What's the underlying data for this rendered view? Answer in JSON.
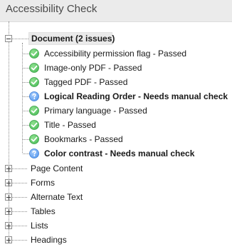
{
  "panel": {
    "title": "Accessibility Check"
  },
  "tree": {
    "root": {
      "label": "Document (2 issues)",
      "expanded": true,
      "children": [
        {
          "label": "Accessibility permission flag - Passed",
          "status": "passed",
          "icon": "check-icon",
          "bold": false
        },
        {
          "label": "Image-only PDF - Passed",
          "status": "passed",
          "icon": "check-icon",
          "bold": false
        },
        {
          "label": "Tagged PDF - Passed",
          "status": "passed",
          "icon": "check-icon",
          "bold": false
        },
        {
          "label": "Logical Reading Order - Needs manual check",
          "status": "manual",
          "icon": "question-icon",
          "bold": true
        },
        {
          "label": "Primary language - Passed",
          "status": "passed",
          "icon": "check-icon",
          "bold": false
        },
        {
          "label": "Title - Passed",
          "status": "passed",
          "icon": "check-icon",
          "bold": false
        },
        {
          "label": "Bookmarks - Passed",
          "status": "passed",
          "icon": "check-icon",
          "bold": false
        },
        {
          "label": "Color contrast - Needs manual check",
          "status": "manual",
          "icon": "question-icon",
          "bold": true
        }
      ]
    },
    "categories": [
      {
        "label": "Page Content",
        "expanded": false
      },
      {
        "label": "Forms",
        "expanded": false
      },
      {
        "label": "Alternate Text",
        "expanded": false
      },
      {
        "label": "Tables",
        "expanded": false
      },
      {
        "label": "Lists",
        "expanded": false
      },
      {
        "label": "Headings",
        "expanded": false
      }
    ]
  },
  "colors": {
    "passed": "#4fbf5c",
    "manual": "#5a9cf0"
  }
}
